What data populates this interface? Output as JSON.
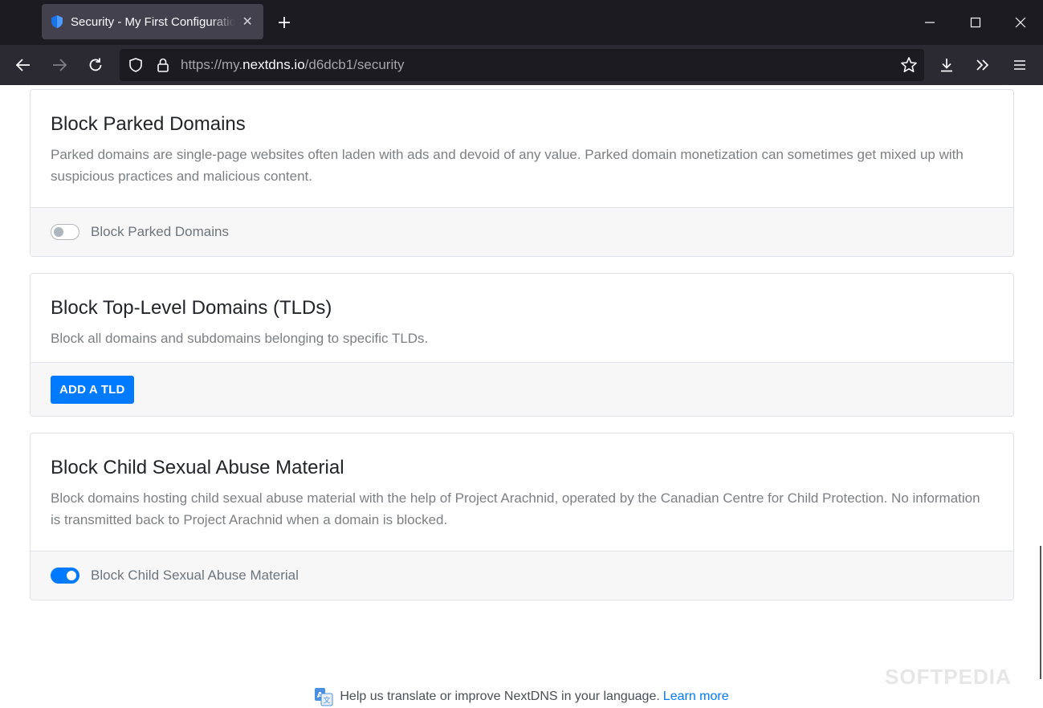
{
  "browser": {
    "tab_title": "Security - My First Configuration",
    "tab_close": "✕",
    "url_prefix": "https://my.",
    "url_host": "nextdns.io",
    "url_path": "/d6dcb1/security"
  },
  "cards": [
    {
      "title": "Block Parked Domains",
      "description": "Parked domains are single-page websites often laden with ads and devoid of any value. Parked domain monetization can sometimes get mixed up with suspicious practices and malicious content.",
      "toggle_label": "Block Parked Domains",
      "toggle_on": false
    },
    {
      "title": "Block Top-Level Domains (TLDs)",
      "description": "Block all domains and subdomains belonging to specific TLDs.",
      "button_label": "ADD A TLD"
    },
    {
      "title": "Block Child Sexual Abuse Material",
      "description": "Block domains hosting child sexual abuse material with the help of Project Arachnid, operated by the Canadian Centre for Child Protection. No information is transmitted back to Project Arachnid when a domain is blocked.",
      "toggle_label": "Block Child Sexual Abuse Material",
      "toggle_on": true
    }
  ],
  "footer": {
    "text": "Help us translate or improve NextDNS in your language.",
    "link": "Learn more"
  },
  "watermark": "SOFTPEDIA",
  "colors": {
    "accent": "#007bff",
    "titlebar": "#1c1b22",
    "navbar": "#2b2a33"
  }
}
